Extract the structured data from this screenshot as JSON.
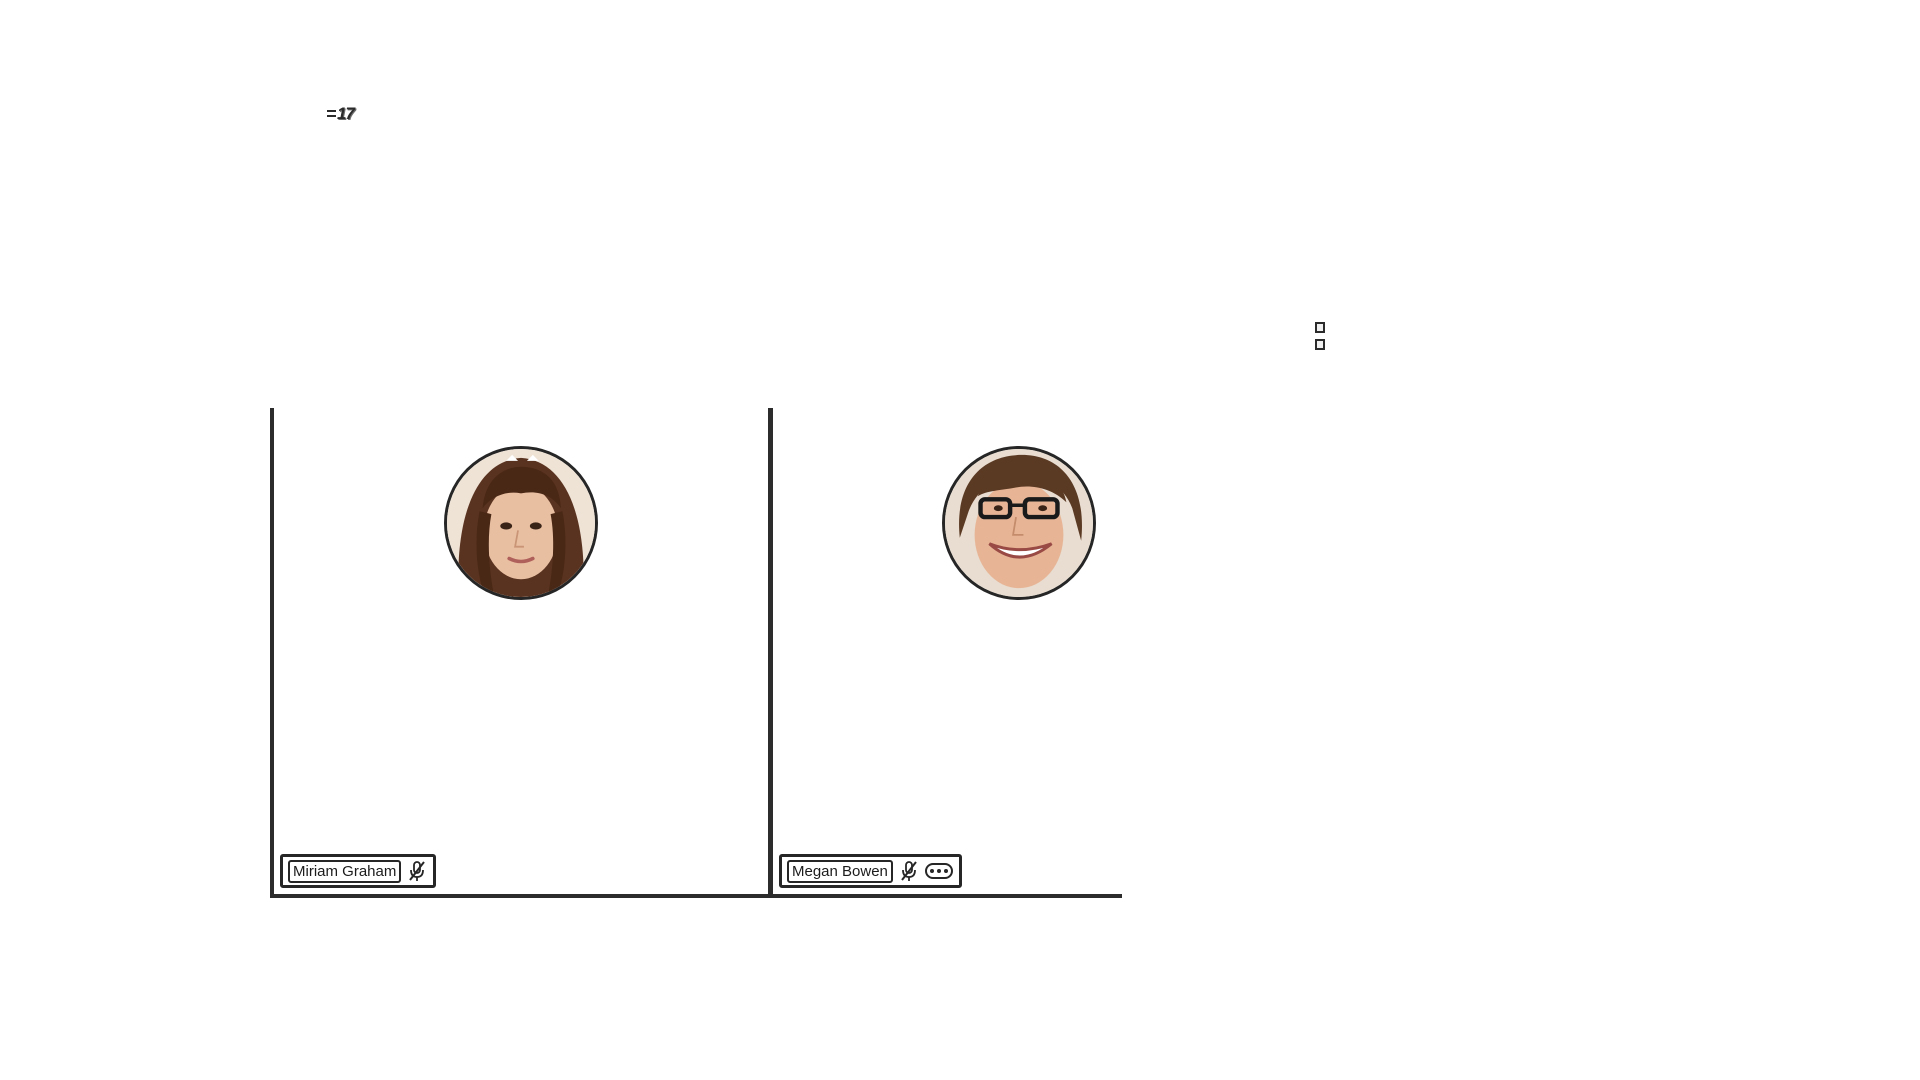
{
  "meeting": {
    "participant_count": "17"
  },
  "participants": [
    {
      "name": "Miriam Graham",
      "avatar": "avatar-photo",
      "status_icon": "microphone-off-icon",
      "has_more_options": false
    },
    {
      "name": "Megan Bowen",
      "avatar": "avatar-photo",
      "status_icon": "microphone-off-icon",
      "has_more_options": true
    }
  ],
  "icons": {
    "participant_count": "people-icon",
    "side_control": "expand-icon",
    "mute": "microphone-off-icon",
    "more": "more-options-icon"
  },
  "colors": {
    "background": "#ffffff",
    "border": "#2c2c2c",
    "text": "#1b1b1b"
  }
}
